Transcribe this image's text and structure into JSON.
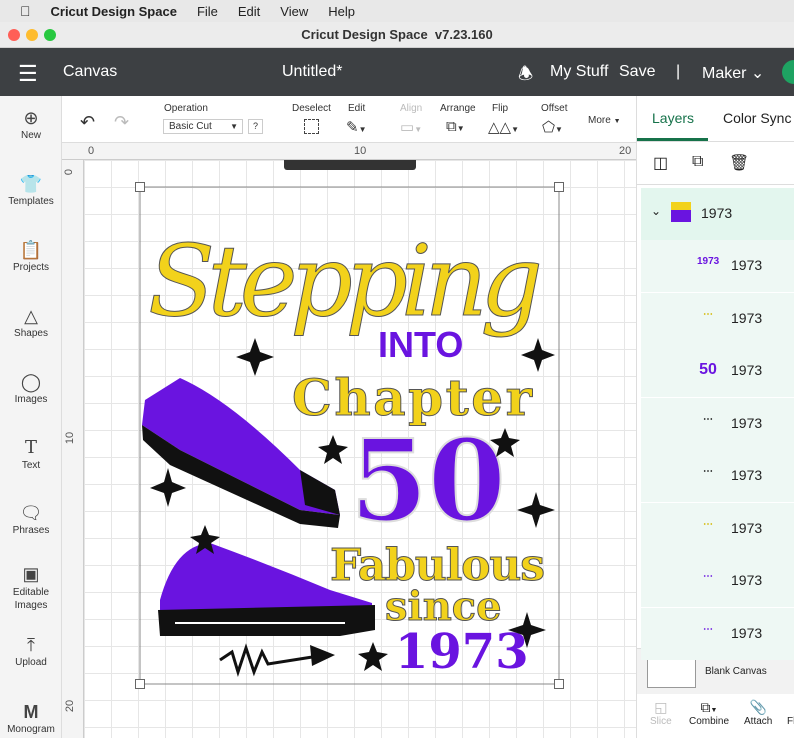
{
  "menubar": {
    "app": "Cricut Design Space",
    "items": [
      "File",
      "Edit",
      "View",
      "Help"
    ]
  },
  "window": {
    "title": "Cricut Design Space  v7.23.160"
  },
  "header": {
    "section": "Canvas",
    "doc_title": "Untitled*",
    "my_stuff": "My Stuff",
    "save": "Save",
    "machine": "Maker"
  },
  "sidebar": {
    "items": [
      {
        "label": "New",
        "icon": "plus-circle-icon"
      },
      {
        "label": "Templates",
        "icon": "shirt-icon"
      },
      {
        "label": "Projects",
        "icon": "clipboard-icon"
      },
      {
        "label": "Shapes",
        "icon": "shapes-icon"
      },
      {
        "label": "Images",
        "icon": "lightbulb-icon"
      },
      {
        "label": "Text",
        "icon": "text-icon"
      },
      {
        "label": "Phrases",
        "icon": "speech-bubble-icon"
      },
      {
        "label": "Editable Images",
        "icon": "editable-image-icon"
      },
      {
        "label": "Upload",
        "icon": "upload-icon"
      },
      {
        "label": "Monogram",
        "icon": "monogram-icon"
      }
    ]
  },
  "toolbar": {
    "operation_label": "Operation",
    "operation_value": "Basic Cut",
    "help": "?",
    "deselect": "Deselect",
    "edit": "Edit",
    "align": "Align",
    "arrange": "Arrange",
    "flip": "Flip",
    "offset": "Offset",
    "more": "More"
  },
  "rulers": {
    "top": [
      "0",
      "10",
      "20"
    ],
    "left": [
      "0",
      "10",
      "20"
    ]
  },
  "artwork": {
    "line1": "Stepping",
    "line2": "INTO",
    "line3": "Chapter",
    "line4": "50",
    "line5": "Fabulous",
    "line6": "since",
    "line7": "1973",
    "colors": {
      "yellow": "#f2d21b",
      "purple": "#6a14e0",
      "black": "#111111"
    }
  },
  "panel": {
    "tabs": [
      "Layers",
      "Color Sync"
    ],
    "group_name": "1973",
    "layers": [
      {
        "thumb": "1973",
        "name": "1973"
      },
      {
        "thumb": "Fabulous since",
        "name": "1973"
      },
      {
        "thumb": "50",
        "name": "1973"
      },
      {
        "thumb": "stars",
        "name": "1973"
      },
      {
        "thumb": "arrow",
        "name": "1973"
      },
      {
        "thumb": "Chapter",
        "name": "1973"
      },
      {
        "thumb": "shoe",
        "name": "1973"
      },
      {
        "thumb": "shoe-sole",
        "name": "1973"
      }
    ],
    "blank_canvas": "Blank Canvas",
    "bottom": [
      "Slice",
      "Combine",
      "Attach",
      "Fl"
    ]
  }
}
